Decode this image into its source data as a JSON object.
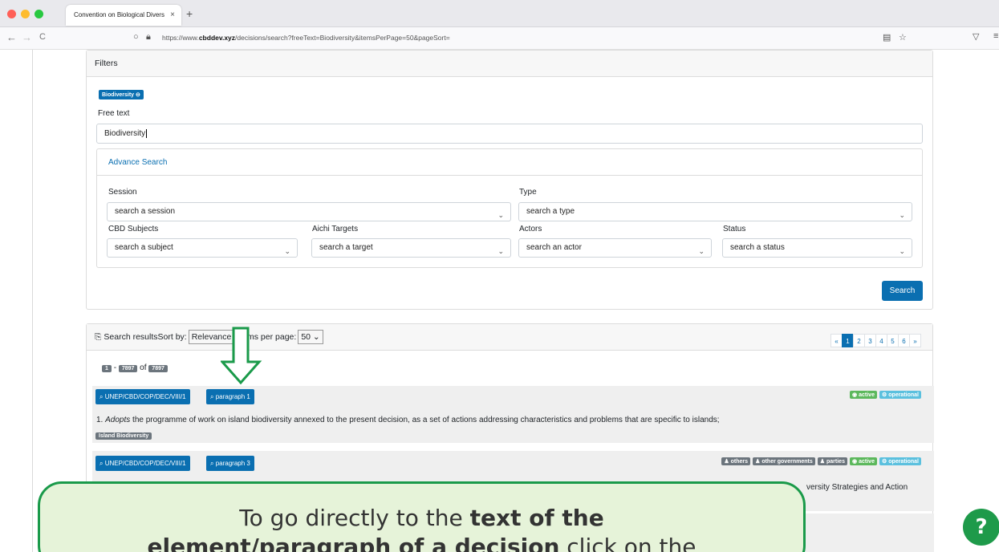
{
  "browser": {
    "tab_title": "Convention on Biological Divers",
    "tab_close": "×",
    "new_tab": "+",
    "url_prefix": "https://www.",
    "url_domain": "cbddev.xyz",
    "url_rest": "/decisions/search?freeText=Biodiversity&itemsPerPage=50&pageSort=",
    "back": "←",
    "forward": "→",
    "reload": "C"
  },
  "filters": {
    "header": "Filters",
    "active_chip": "Biodiversity ⊖",
    "free_text_label": "Free text",
    "free_text_value": "Biodiversity",
    "advance_search_label": "Advance Search",
    "session_label": "Session",
    "session_placeholder": "search a session",
    "type_label": "Type",
    "type_placeholder": "search a type",
    "subjects_label": "CBD Subjects",
    "subjects_placeholder": "search a subject",
    "aichi_label": "Aichi Targets",
    "aichi_placeholder": "search a target",
    "actors_label": "Actors",
    "actors_placeholder": "search an actor",
    "status_label": "Status",
    "status_placeholder": "search a status",
    "search_button": "Search"
  },
  "results": {
    "header_label": "Search results",
    "sort_by_label": "Sort by:",
    "sort_value": "Relevance",
    "items_per_page_label": "Items per page:",
    "items_per_page_value": "50",
    "range_start": "1",
    "range_dash": "-",
    "range_end": "7897",
    "of_label": "of",
    "total": "7897",
    "pager": [
      "«",
      "1",
      "2",
      "3",
      "4",
      "5",
      "6",
      "»"
    ],
    "items": [
      {
        "decision": "UNEP/CBD/COP/DEC/VIII/1",
        "paragraph": "paragraph 1",
        "badges": [
          "active",
          "operational"
        ],
        "text_prefix": "1. ",
        "text_italic": "Adopts",
        "text_rest": " the programme of work on island biodiversity annexed to the present decision, as a set of actions addressing characteristics and problems that are specific to islands;",
        "tag": "Island Biodiversity"
      },
      {
        "decision": "UNEP/CBD/COP/DEC/VIII/1",
        "paragraph": "paragraph 3",
        "badges": [
          "others",
          "other governments",
          "parties",
          "active",
          "operational"
        ],
        "text_visible": "versity Strategies and Action"
      }
    ]
  },
  "callout": {
    "line1_prefix": "To go directly to the ",
    "line1_bold": "text of the",
    "line2_bold": "element/paragraph of a decision",
    "line2_rest": " click on the"
  },
  "help_icon": "?"
}
